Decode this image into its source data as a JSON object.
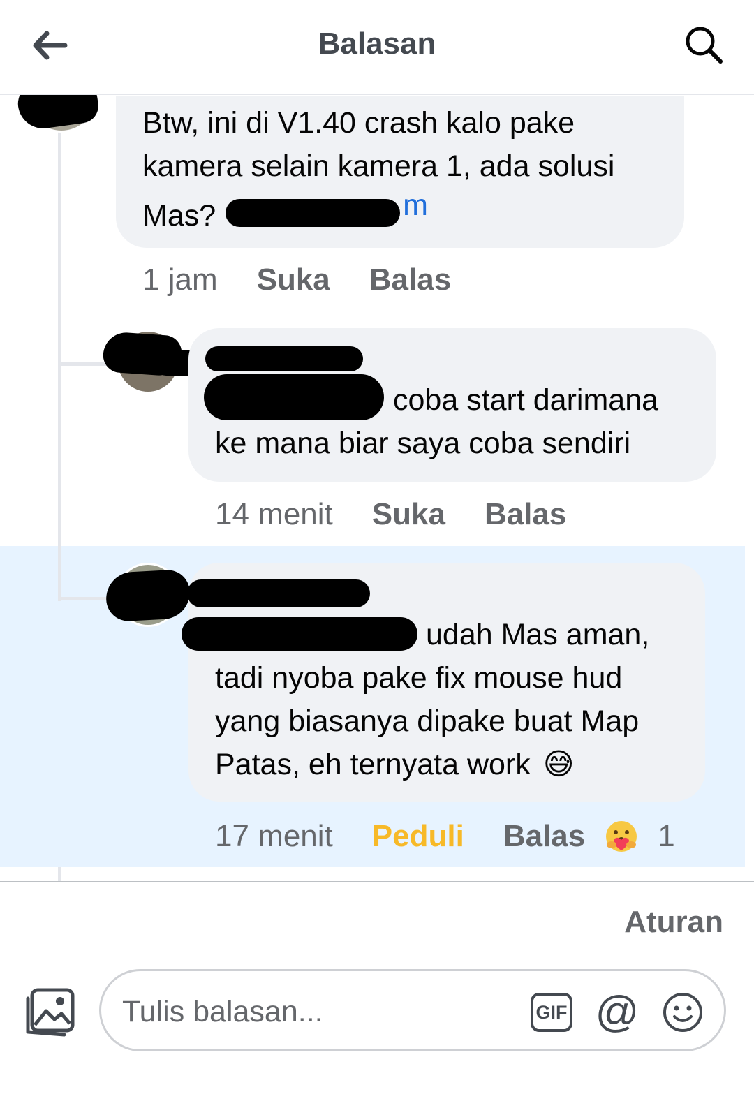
{
  "header": {
    "title": "Balasan",
    "back_icon": "arrow-left-icon",
    "search_icon": "search-icon"
  },
  "comments": [
    {
      "text_before": "Btw, ini di V1.40 crash kalo pake kamera selain kamera 1, ada solusi Mas?",
      "mention_fragment": "m",
      "time": "1 jam",
      "like_label": "Suka",
      "reply_label": "Balas"
    },
    {
      "text_after_mention": "coba start darimana",
      "text_line2": "ke mana biar saya coba sendiri",
      "time": "14 menit",
      "like_label": "Suka",
      "reply_label": "Balas"
    },
    {
      "text_after_mention": "udah Mas aman,",
      "text_rest": "tadi nyoba pake fix mouse hud yang biasanya dipake buat Map Patas, eh ternyata work",
      "emoji": "😅",
      "time": "17 menit",
      "like_label": "Peduli",
      "reply_label": "Balas",
      "reaction_icon": "care-reaction-icon",
      "reaction_count": "1"
    }
  ],
  "footer": {
    "rules_label": "Aturan",
    "composer_placeholder": "Tulis balasan...",
    "gif_label": "GIF",
    "mention_symbol": "@"
  },
  "colors": {
    "highlight": "#e7f3ff",
    "mention": "#216fdb",
    "care": "#f7b928",
    "meta": "#65676b"
  }
}
